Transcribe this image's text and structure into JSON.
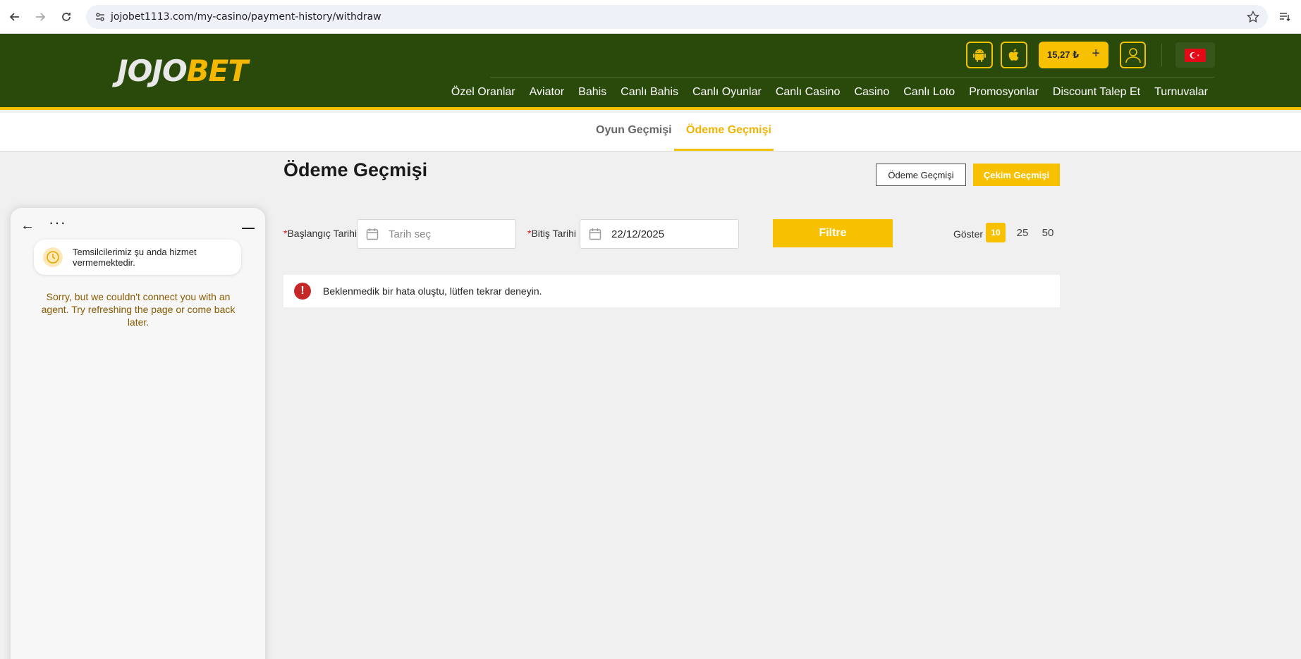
{
  "browser": {
    "url": "jojobet1113.com/my-casino/payment-history/withdraw"
  },
  "header": {
    "logo_part1": "JOJO",
    "logo_part2": "BET",
    "balance": "15,27 ₺",
    "balance_plus": "+",
    "menu": [
      "Özel Oranlar",
      "Aviator",
      "Bahis",
      "Canlı Bahis",
      "Canlı Oyunlar",
      "Canlı Casino",
      "Casino",
      "Canlı Loto",
      "Promosyonlar",
      "Discount Talep Et",
      "Turnuvalar"
    ]
  },
  "subtabs": {
    "game_history": "Oyun Geçmişi",
    "payment_history": "Ödeme Geçmişi"
  },
  "content": {
    "title": "Ödeme Geçmişi",
    "btn_payment_history": "Ödeme Geçmişi",
    "btn_withdraw_history": "Çekim Geçmişi",
    "start_label_req": "*",
    "start_label": "Başlangıç Tarihi",
    "start_placeholder": "Tarih seç",
    "end_label_req": "*",
    "end_label": "Bitiş Tarihi",
    "end_value": "22/12/2025",
    "filter_btn": "Filtre",
    "show_label": "Göster",
    "page_sizes": [
      "10",
      "25",
      "50"
    ],
    "error_icon": "!",
    "error_msg": "Beklenmedik bir hata oluştu, lütfen tekrar deneyin."
  },
  "chat": {
    "back": "←",
    "more": "···",
    "notice": "Temsilcilerimiz şu anda hizmet vermemektedir.",
    "message": "Sorry, but we couldn't connect you with an agent. Try refreshing the page or come back later."
  },
  "colors": {
    "header_bg": "#2a4a0c",
    "accent": "#f7c102",
    "error": "#c62828"
  }
}
